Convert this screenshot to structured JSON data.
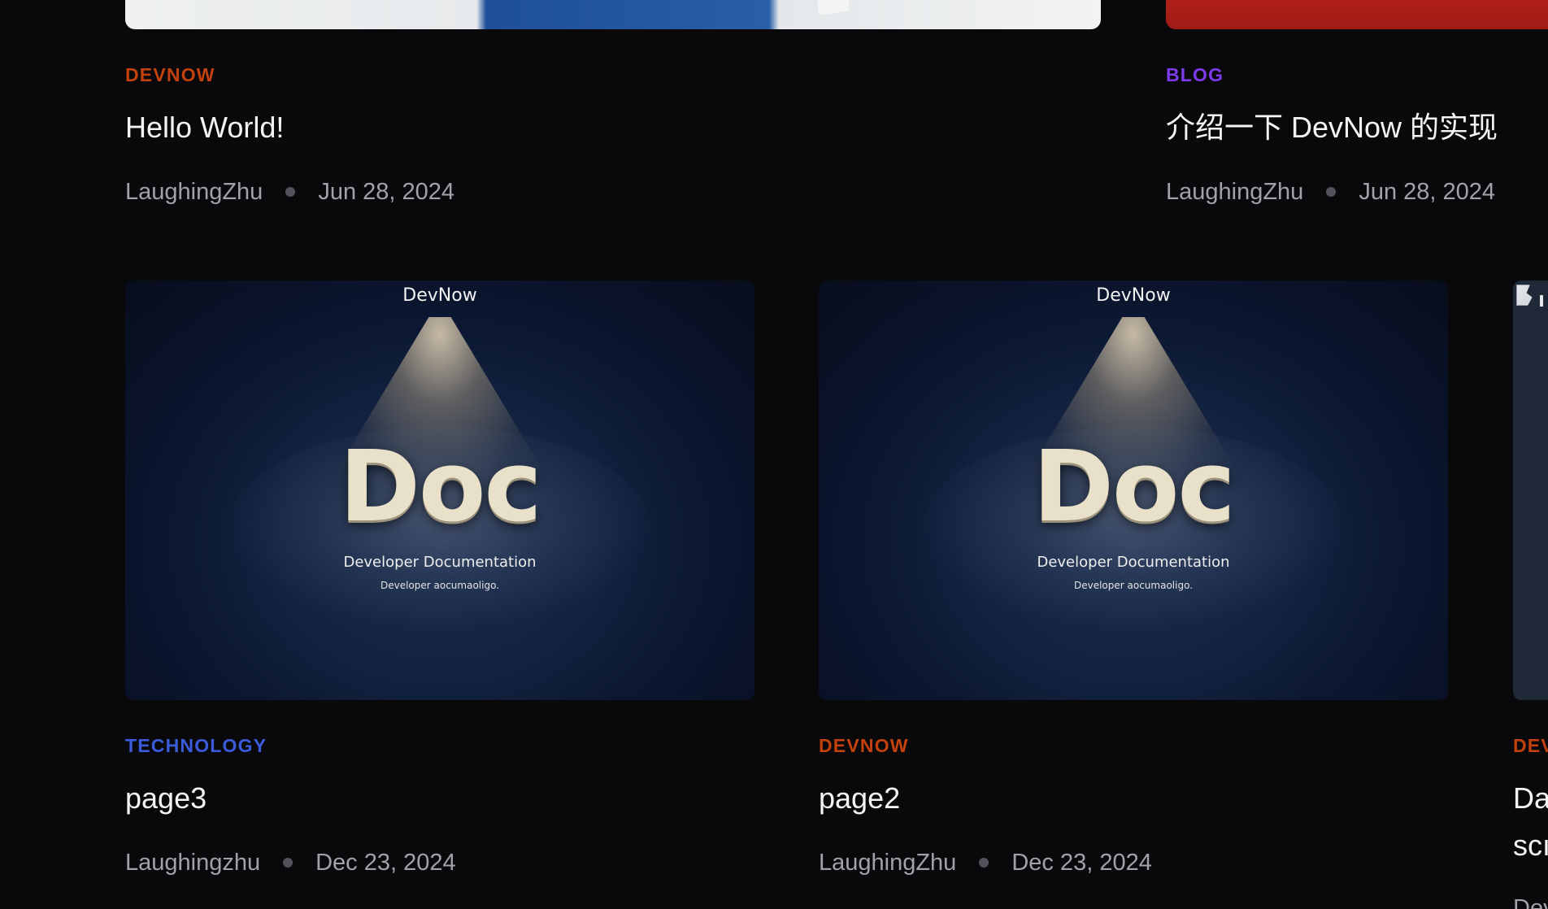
{
  "colors": {
    "background": "#09090b",
    "devnow": "#c2410c",
    "blog": "#7c3aed",
    "technology": "#3b5bdb",
    "title": "#f4f4f5",
    "meta": "#a1a1aa"
  },
  "posts": [
    {
      "category": "DEVNOW",
      "title": "Hello World!",
      "author": "LaughingZhu",
      "date": "Jun 28, 2024"
    },
    {
      "category": "BLOG",
      "title": "介绍一下 DevNow 的实现",
      "author": "LaughingZhu",
      "date": "Jun 28, 2024"
    },
    {
      "category": "TECHNOLOGY",
      "title": "page3",
      "author": "Laughingzhu",
      "date": "Dec 23, 2024",
      "thumbnail": {
        "brand": "DevNow",
        "headline": "Doc",
        "subtitle": "Developer Documentation",
        "caption": "Developer aocumaoligo."
      }
    },
    {
      "category": "DEVNOW",
      "title": "page2",
      "author": "LaughingZhu",
      "date": "Dec 23, 2024",
      "thumbnail": {
        "brand": "DevNow",
        "headline": "Doc",
        "subtitle": "Developer Documentation",
        "caption": "Developer aocumaoligo."
      }
    },
    {
      "category": "DEV",
      "title_lines": [
        "Da",
        "scı"
      ],
      "author": "Dev"
    }
  ]
}
